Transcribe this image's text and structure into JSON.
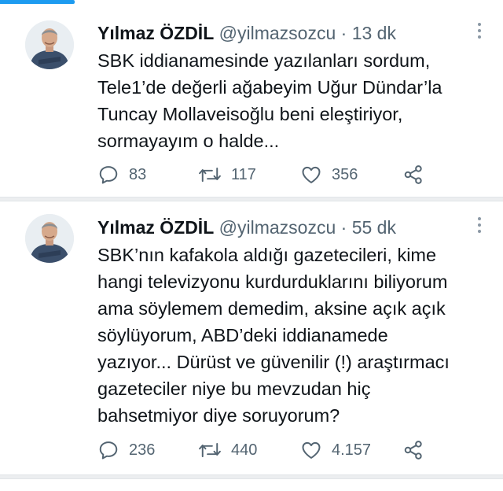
{
  "colors": {
    "accent": "#1d9bf0",
    "text": "#0f1419",
    "secondary": "#536471",
    "divider": "#eceef0"
  },
  "tweets": [
    {
      "author_name": "Yılmaz ÖZDİL",
      "handle": "@yilmazsozcu",
      "separator": "·",
      "time": "13 dk",
      "text_lines": [
        "SBK iddianamesinde yazılanları sordum,",
        "Tele1’de değerli ağabeyim Uğur Dündar’la",
        "Tuncay Mollaveisoğlu beni eleştiriyor,",
        "sormayayım o halde..."
      ],
      "replies": "83",
      "retweets": "117",
      "likes": "356",
      "icons": [
        "reply-icon",
        "retweet-icon",
        "like-icon",
        "share-icon",
        "more-icon"
      ]
    },
    {
      "author_name": "Yılmaz ÖZDİL",
      "handle": "@yilmazsozcu",
      "separator": "·",
      "time": "55 dk",
      "text_lines": [
        "SBK’nın kafakola aldığı gazetecileri, kime",
        "hangi televizyonu kurdurduklarını biliyorum",
        "ama söylemem demedim, aksine açık açık",
        "söylüyorum, ABD’deki iddianamede",
        "yazıyor... Dürüst ve güvenilir (!) araştırmacı",
        "gazeteciler niye bu mevzudan hiç",
        "bahsetmiyor diye soruyorum?"
      ],
      "replies": "236",
      "retweets": "440",
      "likes": "4.157",
      "icons": [
        "reply-icon",
        "retweet-icon",
        "like-icon",
        "share-icon",
        "more-icon"
      ]
    }
  ]
}
